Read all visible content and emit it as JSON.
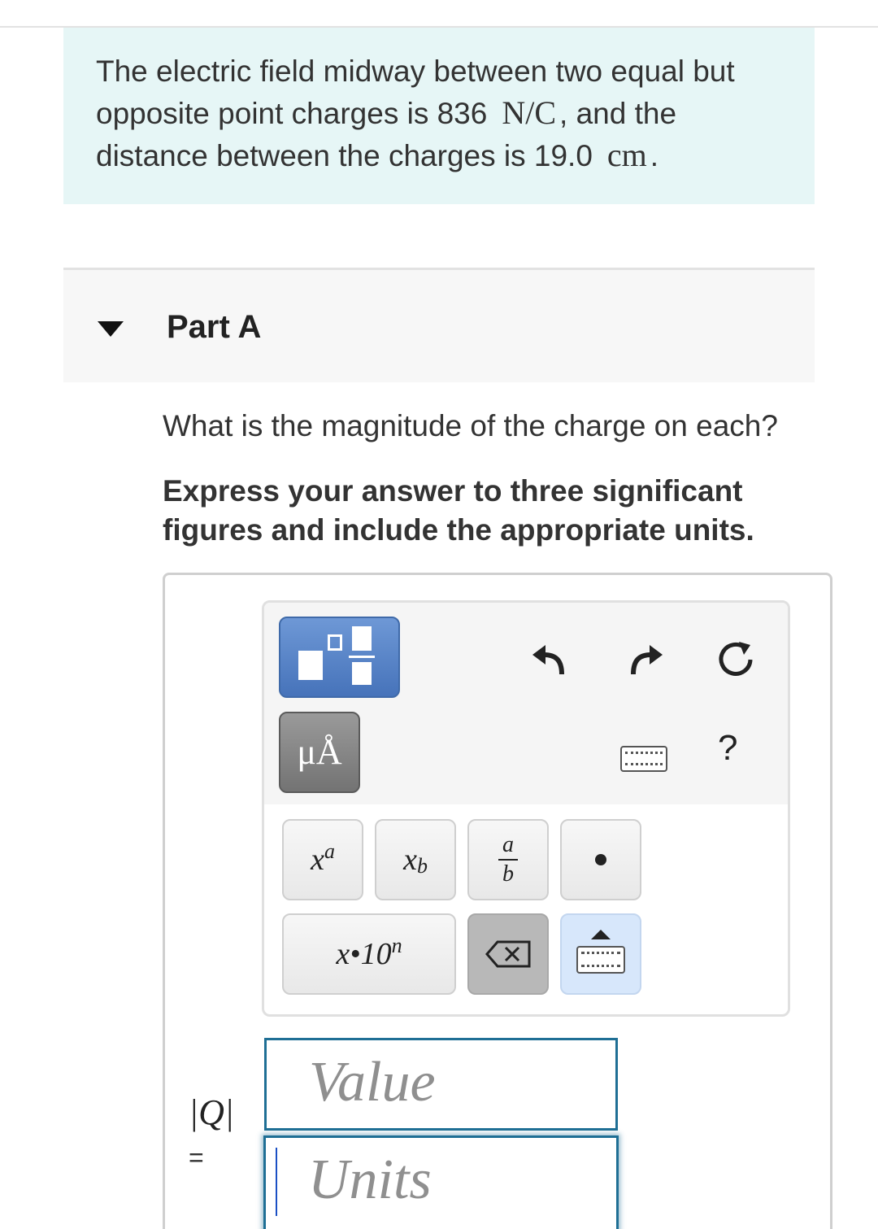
{
  "problem": {
    "text_part1": "The electric field midway between two equal but opposite point charges is 836",
    "field_unit": "N/C",
    "text_part2": ", and the distance between the charges is 19.0",
    "distance_unit": "cm",
    "text_end": "."
  },
  "part": {
    "title": "Part A",
    "question": "What is the magnitude of the charge on each?",
    "instruction": "Express your answer to three significant figures and include the appropriate units."
  },
  "toolbar": {
    "units_button_label": "μÅ",
    "help_label": "?",
    "icons": [
      "templates-icon",
      "units-icon",
      "undo-icon",
      "redo-icon",
      "reset-icon",
      "keyboard-icon",
      "help-icon"
    ],
    "keys": {
      "superscript": {
        "base": "x",
        "exp": "a"
      },
      "subscript": {
        "base": "x",
        "sub": "b"
      },
      "fraction": {
        "num": "a",
        "den": "b"
      },
      "sci_notation": {
        "base": "x•10",
        "exp": "n"
      }
    }
  },
  "answer": {
    "label": "|Q|",
    "equals": "=",
    "value_placeholder": "Value",
    "units_placeholder": "Units"
  },
  "colors": {
    "problem_bg": "#e6f6f6",
    "template_button": "#4673ba",
    "units_button": "#737373",
    "field_border": "#1f6f95"
  }
}
